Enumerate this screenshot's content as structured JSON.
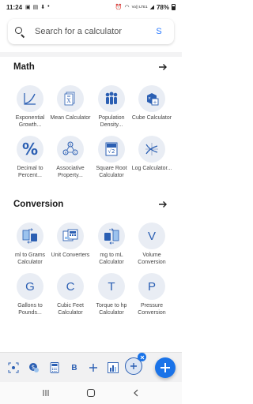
{
  "status": {
    "time": "11:24",
    "battery": "78%",
    "network": "Vo)) LTE1"
  },
  "search": {
    "placeholder": "Search for a calculator",
    "avatar": "S"
  },
  "sections": [
    {
      "title": "Math"
    },
    {
      "title": "Conversion"
    }
  ],
  "math_items": [
    {
      "label": "Exponential Growth...",
      "icon": "exponential-curve-icon"
    },
    {
      "label": "Mean Calculator",
      "icon": "mean-x-bar-icon"
    },
    {
      "label": "Population Density...",
      "icon": "people-icon"
    },
    {
      "label": "Cube Calculator",
      "icon": "cube-calculator-icon"
    },
    {
      "label": "Decimal to Percent...",
      "icon": "percent-icon"
    },
    {
      "label": "Associative Property...",
      "icon": "associative-nodes-icon"
    },
    {
      "label": "Square Root Calculator",
      "icon": "square-root-icon"
    },
    {
      "label": "Log Calculator...",
      "icon": "log-curve-icon"
    }
  ],
  "conversion_items": [
    {
      "label": "ml to Grams Calculator",
      "icon": "ml-to-grams-icon"
    },
    {
      "label": "Unit Converters",
      "icon": "unit-converters-icon"
    },
    {
      "label": "mg to mL Calculator",
      "icon": "mg-to-ml-icon"
    },
    {
      "label": "Volume Conversion",
      "letter": "V"
    },
    {
      "label": "Gallons to Pounds...",
      "letter": "G"
    },
    {
      "label": "Cubic Feet Calculator",
      "letter": "C"
    },
    {
      "label": "Torque to hp Calculator",
      "letter": "T"
    },
    {
      "label": "Pressure Conversion",
      "letter": "P"
    }
  ],
  "tray": {
    "b_label": "B",
    "items": [
      "scan-icon",
      "currency-icon",
      "calculator-icon",
      "letter-b-icon",
      "plus-icon",
      "chart-icon",
      "add-remove-icon"
    ]
  },
  "colors": {
    "accent": "#1a73e8",
    "icon_bg": "#e9edf4",
    "icon_blue": "#2b5fb3"
  }
}
